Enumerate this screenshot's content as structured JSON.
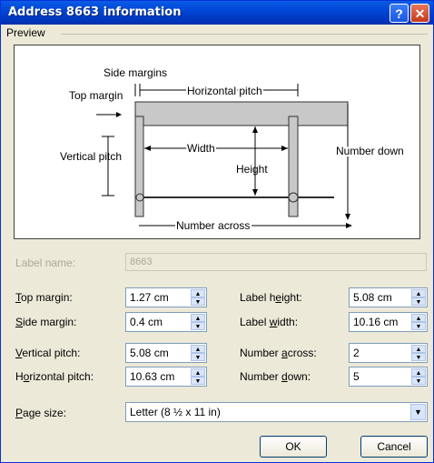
{
  "window": {
    "title": "Address 8663 information",
    "help_label": "?",
    "close_label": "✕"
  },
  "preview": {
    "group_label": "Preview",
    "side_margins": "Side margins",
    "top_margin": "Top margin",
    "horizontal_pitch": "Horizontal pitch",
    "vertical_pitch": "Vertical pitch",
    "width": "Width",
    "height": "Height",
    "number_down": "Number down",
    "number_across": "Number across"
  },
  "form": {
    "label_name": {
      "label": "Label name:",
      "value": "8663"
    },
    "top_margin": {
      "label_pre": "",
      "label_u": "T",
      "label_post": "op margin:",
      "value": "1.27 cm"
    },
    "side_margin": {
      "label_pre": "",
      "label_u": "S",
      "label_post": "ide margin:",
      "value": "0.4 cm"
    },
    "vertical_pitch": {
      "label_pre": "",
      "label_u": "V",
      "label_post": "ertical pitch:",
      "value": "5.08 cm"
    },
    "horizontal_pitch": {
      "label_pre": "H",
      "label_u": "o",
      "label_post": "rizontal pitch:",
      "value": "10.63 cm"
    },
    "label_height": {
      "label_pre": "Label h",
      "label_u": "e",
      "label_post": "ight:",
      "value": "5.08 cm"
    },
    "label_width": {
      "label_pre": "Label ",
      "label_u": "w",
      "label_post": "idth:",
      "value": "10.16 cm"
    },
    "number_across": {
      "label_pre": "Number ",
      "label_u": "a",
      "label_post": "cross:",
      "value": "2"
    },
    "number_down": {
      "label_pre": "Number ",
      "label_u": "d",
      "label_post": "own:",
      "value": "5"
    },
    "page_size": {
      "label_pre": "",
      "label_u": "P",
      "label_post": "age size:",
      "value": "Letter (8 ½ x 11 in)"
    }
  },
  "buttons": {
    "ok": "OK",
    "cancel": "Cancel"
  },
  "icons": {
    "up": "▲",
    "down": "▼",
    "dropdown": "▼"
  }
}
